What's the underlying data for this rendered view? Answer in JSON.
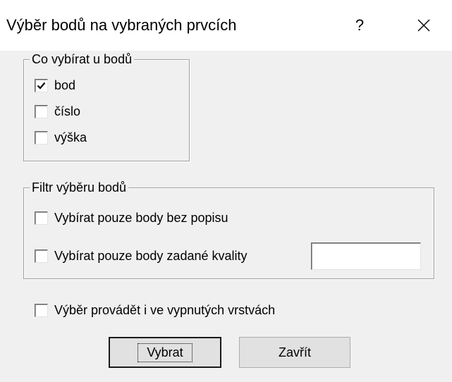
{
  "titlebar": {
    "title": "Výběr bodů na vybraných prvcích",
    "help_label": "?"
  },
  "group_what": {
    "label": "Co vybírat u bodů",
    "options": [
      {
        "label": "bod",
        "checked": true
      },
      {
        "label": "číslo",
        "checked": false
      },
      {
        "label": "výška",
        "checked": false
      }
    ]
  },
  "group_filter": {
    "label": "Filtr výběru bodů",
    "without_description": {
      "label": "Vybírat pouze body bez popisu",
      "checked": false
    },
    "quality": {
      "label": "Vybírat pouze body zadané kvality",
      "checked": false,
      "value": ""
    }
  },
  "hidden_layers": {
    "label": "Výběr provádět i ve vypnutých vrstvách",
    "checked": false
  },
  "buttons": {
    "select_label": "Vybrat",
    "close_label": "Zavřít"
  }
}
